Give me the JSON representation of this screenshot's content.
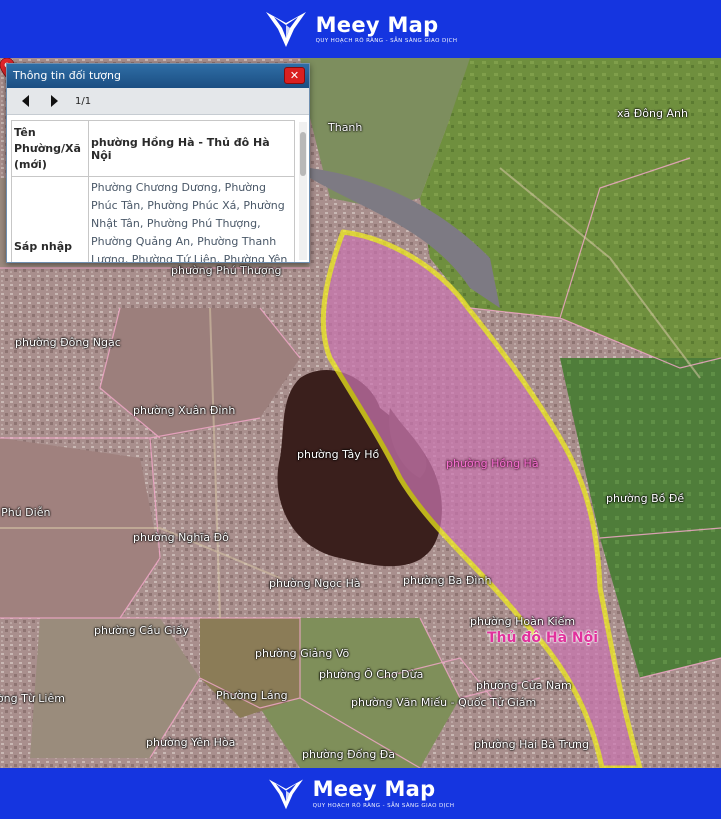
{
  "brand": {
    "name": "Meey Map",
    "tagline": "QUY HOẠCH RÕ RÀNG - SẴN SÀNG GIAO DỊCH"
  },
  "info_panel": {
    "title": "Thông tin đối tượng",
    "close_label": "✕",
    "pagination": "1/1",
    "rows": [
      {
        "key": "Tên Phường/Xã (mới)",
        "value": "phường Hồng Hà - Thủ đô Hà Nội"
      },
      {
        "key": "Sáp nhập",
        "value": "Phường Chương Dương, Phường Phúc Tân, Phường Phúc Xá, Phường Nhật Tân, Phường Phú Thượng, Phường Quảng An, Phường Thanh Lương, Phường Tứ Liên, Phường Yên Phụ,..."
      }
    ]
  },
  "map": {
    "selected_ward": "phường Hồng Hà",
    "capital_label": "Thủ đô Hà Nội",
    "highlight_color": "#f2ee1d",
    "selected_fill": "#cc6fa8",
    "labels": [
      "Thanh",
      "xã Đông Anh",
      "phường Phú Thượng",
      "phường Đông Ngạc",
      "phường Xuân Đỉnh",
      "phường Tây Hồ",
      "phường Bồ Đề",
      "phường Phú Diễn",
      "phường Nghĩa Đô",
      "phường Ngọc Hà",
      "phường Ba Đình",
      "phường Hoàn Kiếm",
      "phường Cầu Giấy",
      "phường Giảng Võ",
      "phường Ô Chợ Dừa",
      "phường Cửa Nam",
      "Phường Láng",
      "phường Văn Miếu - Quốc Tử Giám",
      "phường Từ Liêm",
      "phường Yên Hòa",
      "phường Đống Đa",
      "phường Hai Bà Trưng"
    ]
  }
}
